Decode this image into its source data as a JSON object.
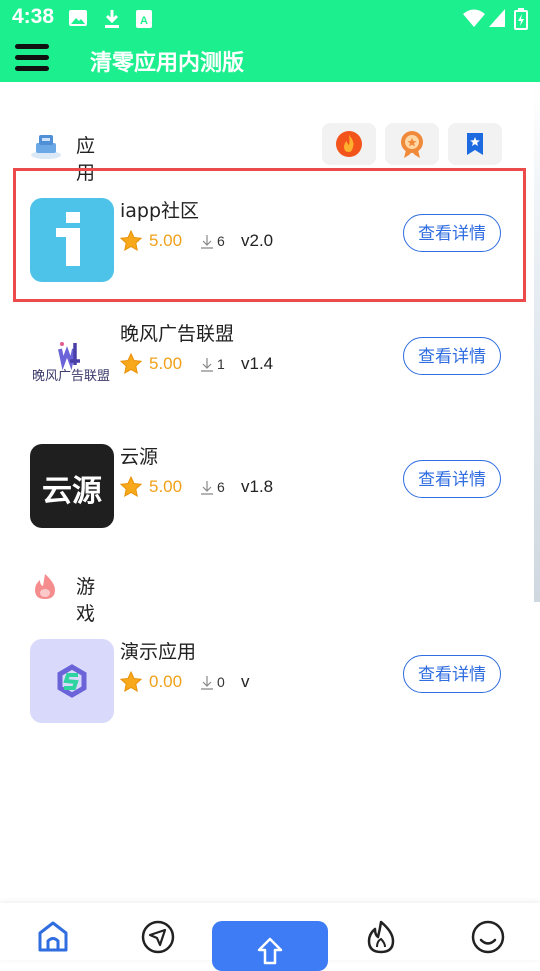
{
  "status_bar": {
    "time": "4:38",
    "icons": [
      "image-icon",
      "download-icon",
      "keyboard-icon",
      "wifi-icon",
      "signal-icon",
      "battery-icon"
    ]
  },
  "header": {
    "title": "清零应用内测版",
    "menu_icon": "hamburger-menu-icon"
  },
  "sections": [
    {
      "label": "应用",
      "icon": "app-category-icon"
    },
    {
      "label": "游戏",
      "icon": "flame-icon"
    }
  ],
  "filters": [
    {
      "icon": "hot-icon",
      "color": "#f2541b"
    },
    {
      "icon": "medal-icon",
      "color": "#f08a3a"
    },
    {
      "icon": "bookmark-icon",
      "color": "#1e6ae0"
    }
  ],
  "apps": [
    {
      "name": "iapp社区",
      "rating": "5.00",
      "downloads": "6",
      "version": "v2.0",
      "button": "查看详情"
    },
    {
      "name": "晚风广告联盟",
      "rating": "5.00",
      "downloads": "1",
      "version": "v1.4",
      "button": "查看详情",
      "icon_text": "晚风广告联盟"
    },
    {
      "name": "云源",
      "rating": "5.00",
      "downloads": "6",
      "version": "v1.8",
      "button": "查看详情",
      "icon_text": "云源"
    },
    {
      "name": "演示应用",
      "rating": "0.00",
      "downloads": "0",
      "version": "v",
      "button": "查看详情"
    }
  ],
  "bottom_nav": [
    "home-icon",
    "navigation-icon",
    "upload-icon",
    "flame-icon",
    "smile-icon"
  ],
  "colors": {
    "header": "#1cef8e",
    "accent": "#2f6de0",
    "rating": "#f0a11a",
    "highlight": "#ec4b4b"
  }
}
